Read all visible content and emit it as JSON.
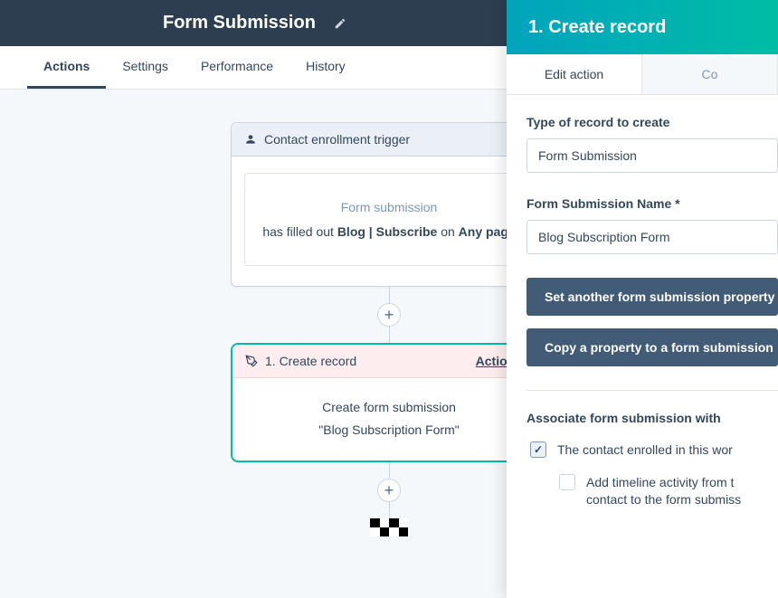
{
  "header": {
    "title": "Form Submission"
  },
  "tabs": {
    "actions": "Actions",
    "settings": "Settings",
    "performance": "Performance",
    "history": "History"
  },
  "trigger_node": {
    "title": "Contact enrollment trigger",
    "type_label": "Form submission",
    "line_prefix": "has filled out ",
    "form_name": "Blog | Subscribe",
    "line_mid": " on ",
    "page_scope": "Any page"
  },
  "action_node": {
    "title": "1. Create record",
    "actions_menu": "Actions",
    "line1": "Create form submission",
    "line2": "\"Blog Subscription Form\""
  },
  "panel": {
    "title": "1. Create record",
    "tab_edit": "Edit action",
    "tab_other": "Co",
    "field1_label": "Type of record to create",
    "field1_value": "Form Submission",
    "field2_label": "Form Submission Name *",
    "field2_value": "Blog Subscription Form",
    "btn1": "Set another form submission property",
    "btn2": "Copy a property to a form submission",
    "assoc_label": "Associate form submission with",
    "cb1_label": "The contact enrolled in this wor",
    "cb2_label1": "Add timeline activity from t",
    "cb2_label2": "contact to the form submiss"
  }
}
